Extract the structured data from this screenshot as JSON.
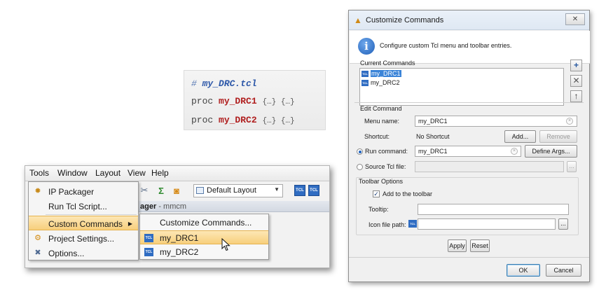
{
  "code": {
    "comment_mark": "#",
    "file_name": "my_DRC.tcl",
    "keyword": "proc",
    "procs": [
      "my_DRC1",
      "my_DRC2"
    ],
    "args": "{…} {…}"
  },
  "vivado": {
    "menubar": [
      "Tools",
      "Window",
      "Layout",
      "View",
      "Help"
    ],
    "layout_select": "Default Layout",
    "tcl_label": "TCL",
    "panel_title": "ager",
    "panel_sub": "- mmcm",
    "tools_menu": [
      "IP Packager",
      "Run Tcl Script...",
      "Custom Commands",
      "Project Settings...",
      "Options..."
    ],
    "submenu": [
      "Customize Commands...",
      "my_DRC1",
      "my_DRC2"
    ]
  },
  "dialog": {
    "title": "Customize Commands",
    "close": "✕",
    "info": "Configure custom Tcl menu and toolbar entries.",
    "current_commands_label": "Current Commands",
    "commands": [
      "my_DRC1",
      "my_DRC2"
    ],
    "side_buttons": [
      "+",
      "✕",
      "↑"
    ],
    "edit_command_label": "Edit Command",
    "menu_name_label": "Menu name:",
    "menu_name_value": "my_DRC1",
    "shortcut_label": "Shortcut:",
    "shortcut_value": "No Shortcut",
    "add_button": "Add...",
    "remove_button": "Remove",
    "run_command_label": "Run command:",
    "run_command_value": "my_DRC1",
    "define_args_button": "Define Args...",
    "source_tcl_label": "Source Tcl file:",
    "browse_button": "...",
    "toolbar_options_label": "Toolbar Options",
    "add_toolbar_label": "Add to the toolbar",
    "tooltip_label": "Tooltip:",
    "icon_path_label": "Icon file path:",
    "apply_button": "Apply",
    "reset_button": "Reset",
    "ok_button": "OK",
    "cancel_button": "Cancel"
  }
}
